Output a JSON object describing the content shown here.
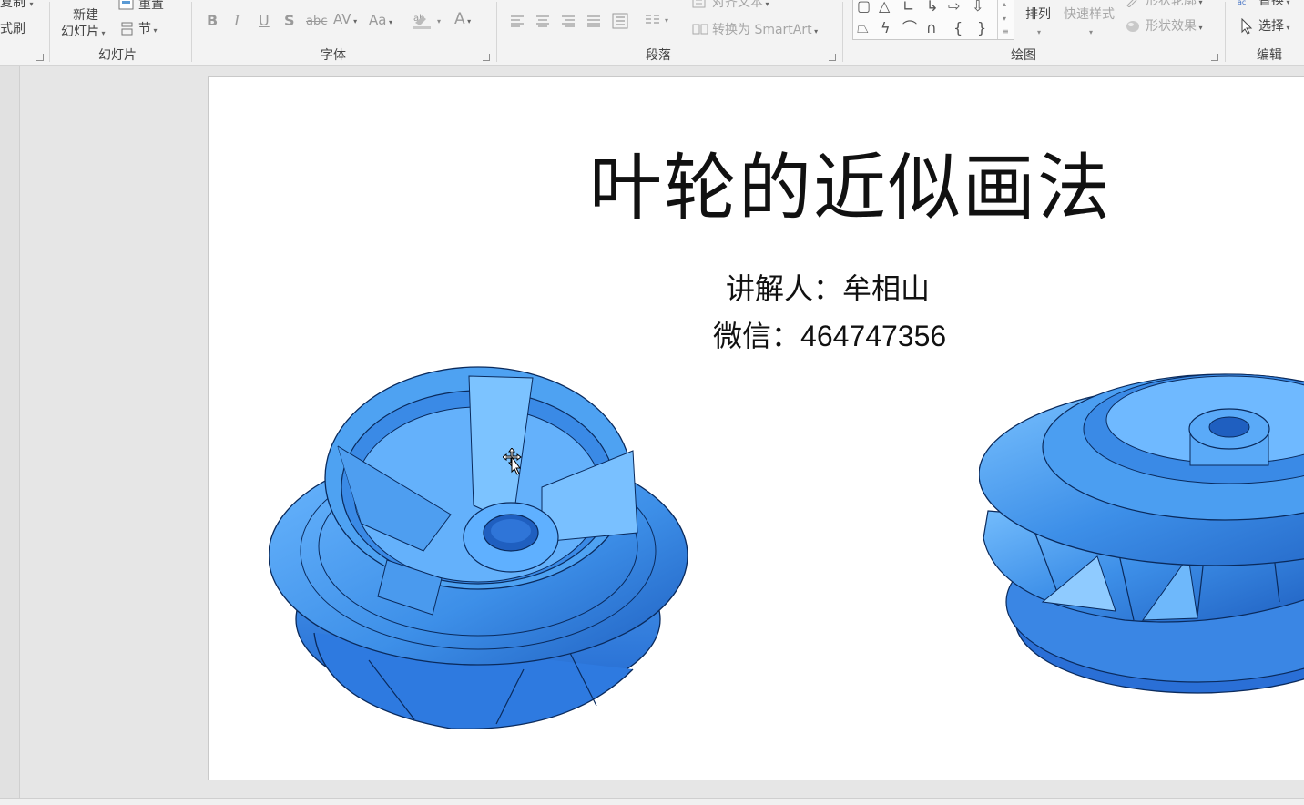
{
  "ribbon": {
    "clipboard": {
      "copy_label": "复制",
      "format_painter_label": "格式刷"
    },
    "slides": {
      "new_slide_line1": "新建",
      "new_slide_line2": "幻灯片",
      "reset_label": "重置",
      "section_label": "节",
      "group_label": "幻灯片"
    },
    "font": {
      "bold": "B",
      "italic": "I",
      "underline": "U",
      "shadow": "S",
      "strike": "abc",
      "spacing": "AV",
      "case": "Aa",
      "color": "A",
      "group_label": "字体"
    },
    "paragraph": {
      "align_text_label": "对齐文本",
      "smartart_label": "转换为 SmartArt",
      "group_label": "段落"
    },
    "drawing": {
      "arrange_label": "排列",
      "quick_styles_label": "快速样式",
      "shape_outline_label": "形状轮廓",
      "shape_effects_label": "形状效果",
      "group_label": "绘图"
    },
    "editing": {
      "replace_label": "替换",
      "select_label": "选择",
      "group_label": "编辑"
    }
  },
  "slide": {
    "title": "叶轮的近似画法",
    "presenter_prefix": "讲解人：",
    "presenter_name": "牟相山",
    "wechat_prefix": "微信：",
    "wechat_number": "464747356"
  },
  "colors": {
    "impeller_blue": "#3d8fe8",
    "impeller_light": "#6cb8ff",
    "impeller_dark": "#1f5fc0"
  }
}
